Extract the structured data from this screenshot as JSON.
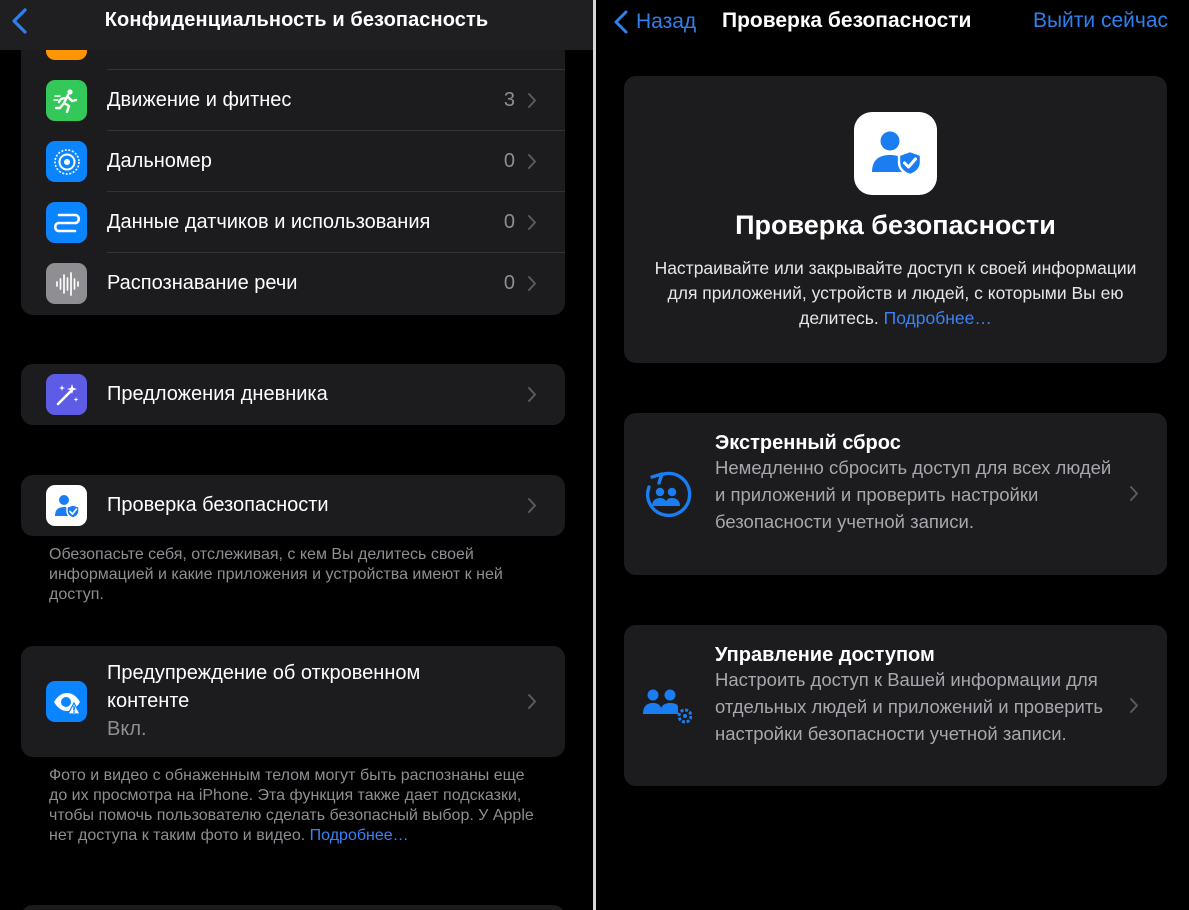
{
  "left": {
    "nav": {
      "title": "Конфиденциальность и безопасность"
    },
    "rows": [
      {
        "label": "Движение и фитнес",
        "count": "3",
        "icon": "running-figure-icon",
        "color": "#34c759"
      },
      {
        "label": "Дальномер",
        "count": "0",
        "icon": "rangefinder-icon",
        "color": "#0a84ff"
      },
      {
        "label": "Данные датчиков и использования",
        "count": "0",
        "icon": "sensor-data-icon",
        "color": "#0a84ff"
      },
      {
        "label": "Распознавание речи",
        "count": "0",
        "icon": "waveform-icon",
        "color": "#8e8e93"
      }
    ],
    "journal": {
      "label": "Предложения дневника",
      "icon": "sparkles-icon",
      "color": "#5e5ce6"
    },
    "safety": {
      "label": "Проверка безопасности",
      "icon": "safety-check-icon",
      "footnote": "Обезопасьте себя, отслеживая, с кем Вы делитесь своей информацией и какие приложения и устройства имеют к ней доступ."
    },
    "sensitive": {
      "label_line1": "Предупреждение об откровенном",
      "label_line2": "контенте",
      "value": "Вкл.",
      "icon": "eye-warning-icon",
      "color": "#0a84ff",
      "footnote": "Фото и видео с обнаженным телом могут быть распознаны еще до их просмотра на iPhone. Эта функция также дает подсказки, чтобы помочь пользователю сделать безопасный выбор. У Apple нет доступа к таким фото и видео.",
      "more": "Подробнее…"
    }
  },
  "right": {
    "nav": {
      "back": "Назад",
      "title": "Проверка безопасности",
      "action": "Выйти сейчас"
    },
    "hero": {
      "title": "Проверка безопасности",
      "text": "Настраивайте или закрывайте доступ к своей информации для приложений, устройств и людей, с которыми Вы ею делитесь.",
      "more": "Подробнее…"
    },
    "options": [
      {
        "title": "Экстренный сброс",
        "text": "Немедленно сбросить доступ для всех людей и приложений и проверить настройки безопасности учетной записи.",
        "icon": "emergency-reset-icon"
      },
      {
        "title": "Управление доступом",
        "text": "Настроить доступ к Вашей информации для отдельных людей и приложений и проверить настройки безопасности учетной записи.",
        "icon": "manage-access-icon"
      }
    ]
  },
  "colors": {
    "accent": "#2f80ed",
    "cell": "#1c1c1e",
    "secondary_text": "#8e8e93"
  }
}
